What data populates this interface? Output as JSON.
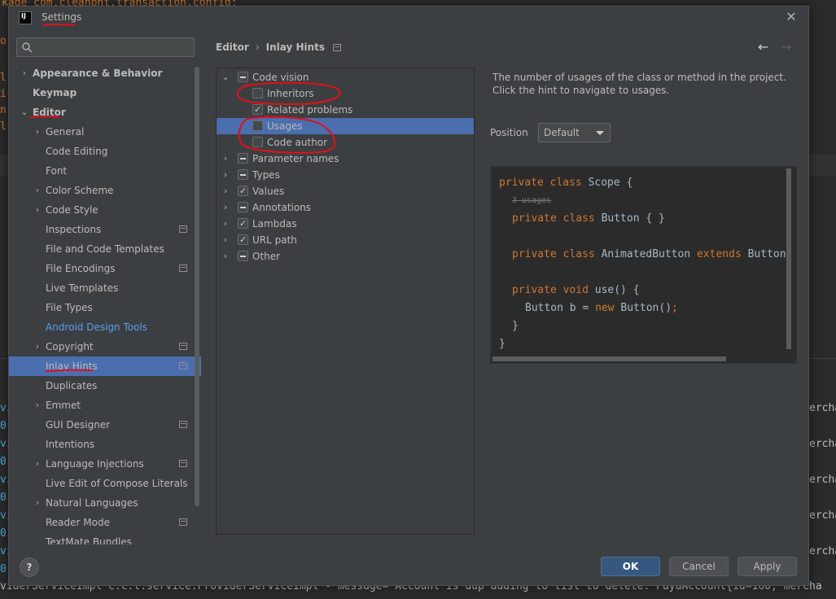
{
  "background": {
    "top_line": "kage com.cleanpnt.transaction.config;",
    "left_fragments": [
      "o",
      "l",
      "i",
      "n",
      "l"
    ],
    "log_left": [
      "vi",
      "0-",
      "vi",
      "0-",
      "vi",
      "0-",
      "vi",
      "0-",
      "vi",
      "0-"
    ],
    "log_right": [
      "ercha",
      "ercha",
      "ercha",
      "ercha",
      "ercha"
    ],
    "bottom_line": "viderServiceImpl c.c.t.service.ProviderServiceImpl - message='Account is dup adding to list to delete: PayaAccount{id=160, mercha"
  },
  "dialog": {
    "icon_text": "IJ",
    "title": "Settings",
    "close_icon": "close-icon"
  },
  "search": {
    "placeholder": "",
    "value": ""
  },
  "sidebar": {
    "items": [
      {
        "label": "Appearance & Behavior",
        "arrow": "›"
      },
      {
        "label": "Keymap"
      },
      {
        "label": "Editor",
        "arrow": "⌄"
      },
      {
        "label": "General",
        "arrow": "›"
      },
      {
        "label": "Code Editing"
      },
      {
        "label": "Font"
      },
      {
        "label": "Color Scheme",
        "arrow": "›"
      },
      {
        "label": "Code Style",
        "arrow": "›"
      },
      {
        "label": "Inspections"
      },
      {
        "label": "File and Code Templates"
      },
      {
        "label": "File Encodings"
      },
      {
        "label": "Live Templates"
      },
      {
        "label": "File Types"
      },
      {
        "label": "Android Design Tools"
      },
      {
        "label": "Copyright",
        "arrow": "›"
      },
      {
        "label": "Inlay Hints"
      },
      {
        "label": "Duplicates"
      },
      {
        "label": "Emmet",
        "arrow": "›"
      },
      {
        "label": "GUI Designer"
      },
      {
        "label": "Intentions"
      },
      {
        "label": "Language Injections",
        "arrow": "›"
      },
      {
        "label": "Live Edit of Compose Literals"
      },
      {
        "label": "Natural Languages",
        "arrow": "›"
      },
      {
        "label": "Reader Mode"
      },
      {
        "label": "TextMate Bundles"
      }
    ]
  },
  "breadcrumb": {
    "parent": "Editor",
    "separator": "›",
    "current": "Inlay Hints"
  },
  "nav": {
    "back": "←",
    "forward": "→"
  },
  "hints": {
    "rows": [
      {
        "label": "Code vision",
        "arrow": "⌄",
        "state": "partial"
      },
      {
        "label": "Inheritors",
        "state": "unchecked"
      },
      {
        "label": "Related problems",
        "state": "checked"
      },
      {
        "label": "Usages",
        "state": "unchecked"
      },
      {
        "label": "Code author",
        "state": "unchecked"
      },
      {
        "label": "Parameter names",
        "arrow": "›",
        "state": "partial"
      },
      {
        "label": "Types",
        "arrow": "›",
        "state": "partial"
      },
      {
        "label": "Values",
        "arrow": "›",
        "state": "checked"
      },
      {
        "label": "Annotations",
        "arrow": "›",
        "state": "partial"
      },
      {
        "label": "Lambdas",
        "arrow": "›",
        "state": "checked"
      },
      {
        "label": "URL path",
        "arrow": "›",
        "state": "checked"
      },
      {
        "label": "Other",
        "arrow": "›",
        "state": "partial"
      }
    ]
  },
  "description": "The number of usages of the class or method in the project. Click the hint to navigate to usages.",
  "position": {
    "label": "Position",
    "value": "Default"
  },
  "preview": {
    "l1_kw": "private class",
    "l1_rest": " Scope {",
    "hint": "3 usages",
    "l2_kw": "private class",
    "l2_rest": " Button { }",
    "l3_kw": "private class",
    "l3_mid": " AnimatedButton ",
    "l3_kw2": "extends",
    "l3_rest": " Button",
    "l4_kw": "private void",
    "l4_rest": " use() {",
    "l5_a": "Button b = ",
    "l5_kw": "new",
    "l5_b": " Button()",
    "l5_semi": ";",
    "l6": "}",
    "l7": "}"
  },
  "buttons": {
    "help": "?",
    "ok": "OK",
    "cancel": "Cancel",
    "apply": "Apply"
  },
  "colors": {
    "accent": "#4b6eaf",
    "link": "#589df6",
    "annotation": "#e0101a",
    "keyword": "#cc7832"
  }
}
